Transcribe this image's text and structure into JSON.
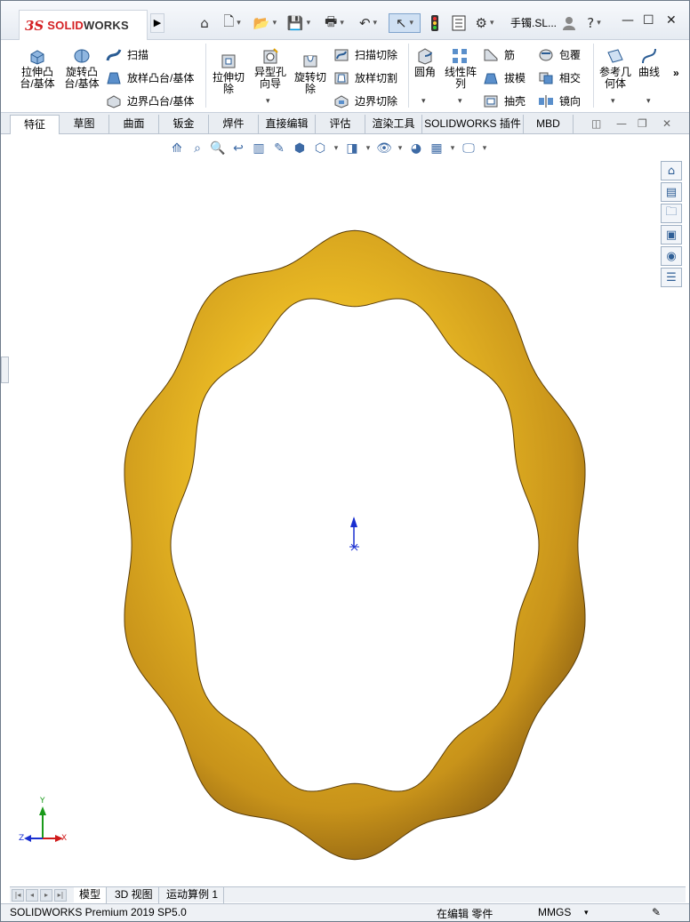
{
  "app": {
    "logo_ds": "3S",
    "logo_solid": "SOLID",
    "logo_works": "WORKS",
    "doc_title": "手镯.SL..."
  },
  "quickbar": {
    "home": "⌂",
    "new": "🗋",
    "open": "📂",
    "save": "💾",
    "print": "🖶",
    "undo": "↶",
    "select": "↖",
    "help": "?",
    "settings": "⚙"
  },
  "ribbon": {
    "extrude_boss": "拉伸凸\n台/基体",
    "revolve_boss": "旋转凸\n台/基体",
    "sweep": "扫描",
    "loft_boss": "放样凸台/基体",
    "boundary_boss": "边界凸台/基体",
    "extrude_cut": "拉伸切\n除",
    "hole_wizard": "异型孔\n向导",
    "revolve_cut": "旋转切\n除",
    "swept_cut": "扫描切除",
    "lofted_cut": "放样切割",
    "boundary_cut": "边界切除",
    "fillet": "圆角",
    "linear_pattern": "线性阵\n列",
    "rib": "筋",
    "draft": "拔模",
    "shell": "抽壳",
    "wrap": "包覆",
    "intersect": "相交",
    "mirror": "镜向",
    "ref_geometry": "参考几\n何体",
    "curves": "曲线",
    "more": "»"
  },
  "tabs": [
    "特征",
    "草图",
    "曲面",
    "钣金",
    "焊件",
    "直接编辑",
    "评估",
    "渲染工具",
    "SOLIDWORKS 插件",
    "MBD"
  ],
  "bottom_tabs": [
    "模型",
    "3D 视图",
    "运动算例 1"
  ],
  "status": {
    "product": "SOLIDWORKS Premium 2019 SP5.0",
    "editing": "在编辑 零件",
    "units": "MMGS"
  },
  "triad": {
    "x": "X",
    "y": "Y",
    "z": "Z"
  },
  "colors": {
    "gold": "#e8b824",
    "gold_dark": "#9a6a10",
    "accent_red": "#d42023",
    "axis_blue": "#1a2fd0"
  }
}
